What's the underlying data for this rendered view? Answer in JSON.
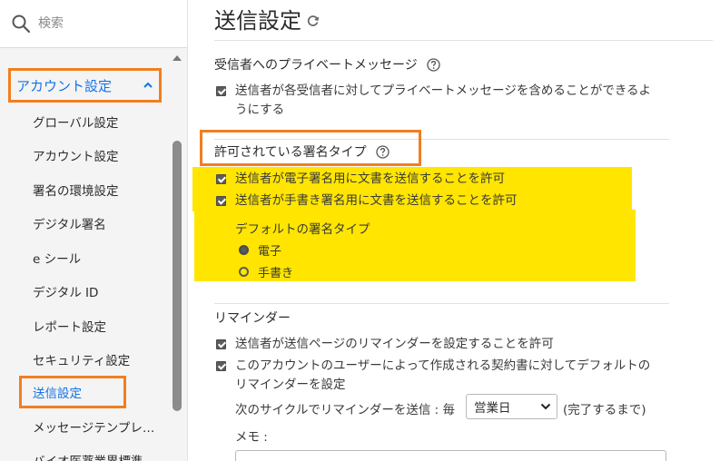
{
  "sidebar": {
    "search_placeholder": "検索",
    "group_label": "アカウント設定",
    "items": [
      {
        "label": "グローバル設定"
      },
      {
        "label": "アカウント設定"
      },
      {
        "label": "署名の環境設定"
      },
      {
        "label": "デジタル署名"
      },
      {
        "label": "e シール"
      },
      {
        "label": "デジタル ID"
      },
      {
        "label": "レポート設定"
      },
      {
        "label": "セキュリティ設定"
      },
      {
        "label": "送信設定"
      },
      {
        "label": "メッセージテンプレ…"
      },
      {
        "label": "バイオ医薬業界標準…"
      }
    ],
    "selected_index": 8
  },
  "main": {
    "title": "送信設定",
    "private_message": {
      "heading": "受信者へのプライベートメッセージ",
      "option_line1": "送信者が各受信者に対してプライベートメッセージを含めることができるよ",
      "option_line2": "うにする",
      "checked": true
    },
    "signature_types": {
      "heading": "許可されている署名タイプ",
      "options": [
        {
          "label": "送信者が電子署名用に文書を送信することを許可",
          "checked": true
        },
        {
          "label": "送信者が手書き署名用に文書を送信することを許可",
          "checked": true
        }
      ],
      "default_heading": "デフォルトの署名タイプ",
      "radios": [
        {
          "label": "電子",
          "selected": true
        },
        {
          "label": "手書き",
          "selected": false
        }
      ]
    },
    "reminders": {
      "heading": "リマインダー",
      "option1": "送信者が送信ページのリマインダーを設定することを許可",
      "option2_line1": "このアカウントのユーザーによって作成される契約書に対してデフォルトの",
      "option2_line2": "リマインダーを設定",
      "cycle_prefix": "次のサイクルでリマインダーを送信 : 毎",
      "cycle_value": "営業日",
      "cycle_suffix": "(完了するまで)",
      "memo_label": "メモ :"
    }
  },
  "colors": {
    "accent_blue": "#1473e6",
    "highlight_orange": "#f07f21",
    "highlight_yellow": "#ffe500"
  }
}
